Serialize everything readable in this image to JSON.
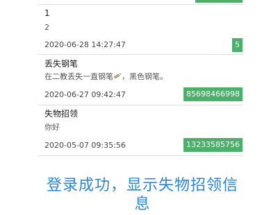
{
  "items": [
    {
      "title": "1",
      "content": "2",
      "time": "2020-06-28 14:27:47",
      "phone": "5"
    },
    {
      "title": "丢失钢笔",
      "content_before": "在二教丢失一直钢笔",
      "content_after": "，黑色钢笔。",
      "time": "2020-06-27 09:42:47",
      "phone": "85698466998"
    },
    {
      "title": "失物招领",
      "content": "你好",
      "time": "2020-05-07 09:35:56",
      "phone": "13233585756"
    }
  ],
  "caption": "登录成功，显示失物招领信息",
  "colors": {
    "badge_green": "#4caf6a",
    "caption_blue": "#2a86d6",
    "divider": "#dcdcdc"
  },
  "icons": {
    "inline_emoji": "pencil-icon"
  }
}
